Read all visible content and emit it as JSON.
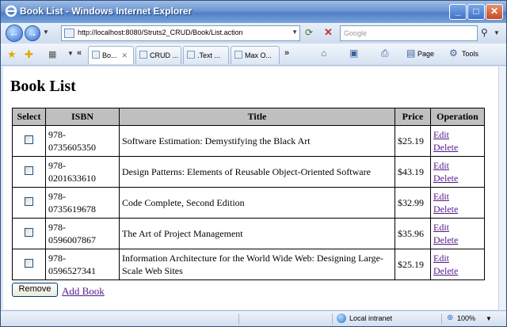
{
  "window": {
    "title": "Book List - Windows Internet Explorer",
    "minimize": "_",
    "maximize": "□",
    "close": "✕"
  },
  "address_bar": {
    "url": "http://localhost:8080/Struts2_CRUD/Book/List.action",
    "search_placeholder": "Google"
  },
  "tabs": [
    {
      "label": "Bo...",
      "active": true
    },
    {
      "label": "CRUD ...",
      "active": false
    },
    {
      "label": ".Text ...",
      "active": false
    },
    {
      "label": "Max O...",
      "active": false
    }
  ],
  "commands": {
    "page": "Page",
    "tools": "Tools"
  },
  "page": {
    "heading": "Book List",
    "columns": [
      "Select",
      "ISBN",
      "Title",
      "Price",
      "Operation"
    ],
    "rows": [
      {
        "isbn1": "978-",
        "isbn2": "0735605350",
        "title": "Software Estimation: Demystifying the Black Art",
        "price": "$25.19"
      },
      {
        "isbn1": "978-",
        "isbn2": "0201633610",
        "title": "Design Patterns: Elements of Reusable Object-Oriented Software",
        "price": "$43.19"
      },
      {
        "isbn1": "978-",
        "isbn2": "0735619678",
        "title": "Code Complete, Second Edition",
        "price": "$32.99"
      },
      {
        "isbn1": "978-",
        "isbn2": "0596007867",
        "title": "The Art of Project Management",
        "price": "$35.96"
      },
      {
        "isbn1": "978-",
        "isbn2": "0596527341",
        "title": "Information Architecture for the World Wide Web: Designing Large-Scale Web Sites",
        "price": "$25.19"
      }
    ],
    "edit_label": "Edit",
    "delete_label": "Delete",
    "remove_label": "Remove",
    "add_label": "Add Book"
  },
  "status": {
    "zone": "Local intranet",
    "zoom": "100%"
  }
}
